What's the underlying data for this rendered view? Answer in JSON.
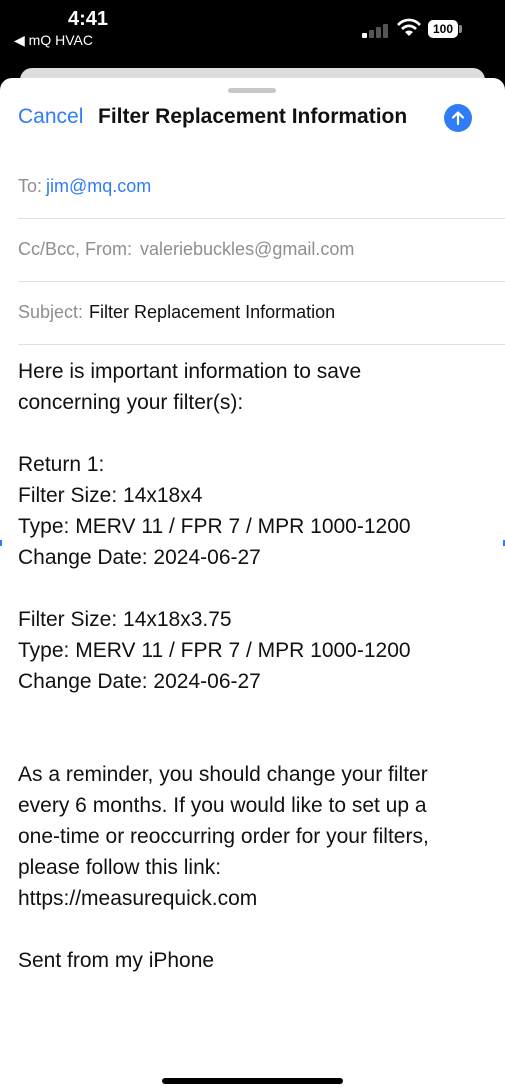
{
  "status": {
    "time": "4:41",
    "back_app": "◀ mQ HVAC",
    "battery": "100"
  },
  "compose": {
    "cancel_label": "Cancel",
    "title": "Filter Replacement Information",
    "to_label": "To:",
    "to_value": "jim@mq.com",
    "ccbcc_label": "Cc/Bcc, From:",
    "from_value": "valeriebuckles@gmail.com",
    "subject_label": "Subject:",
    "subject_value": "Filter Replacement Information"
  },
  "body": {
    "lines": [
      "Here is important information to save",
      "concerning your filter(s):",
      "",
      "Return 1:",
      "Filter Size: 14x18x4",
      "Type: MERV 11 / FPR 7 / MPR 1000-1200",
      "Change Date: 2024-06-27",
      "",
      "Filter Size: 14x18x3.75",
      "Type: MERV 11 / FPR 7 / MPR 1000-1200",
      "Change Date: 2024-06-27",
      "",
      "",
      "As a reminder, you should change your filter",
      "every 6 months. If you would like to set up a",
      "one-time or reoccurring order for your filters,",
      "please follow this link:",
      "https://measurequick.com",
      "",
      "Sent from my iPhone"
    ]
  }
}
